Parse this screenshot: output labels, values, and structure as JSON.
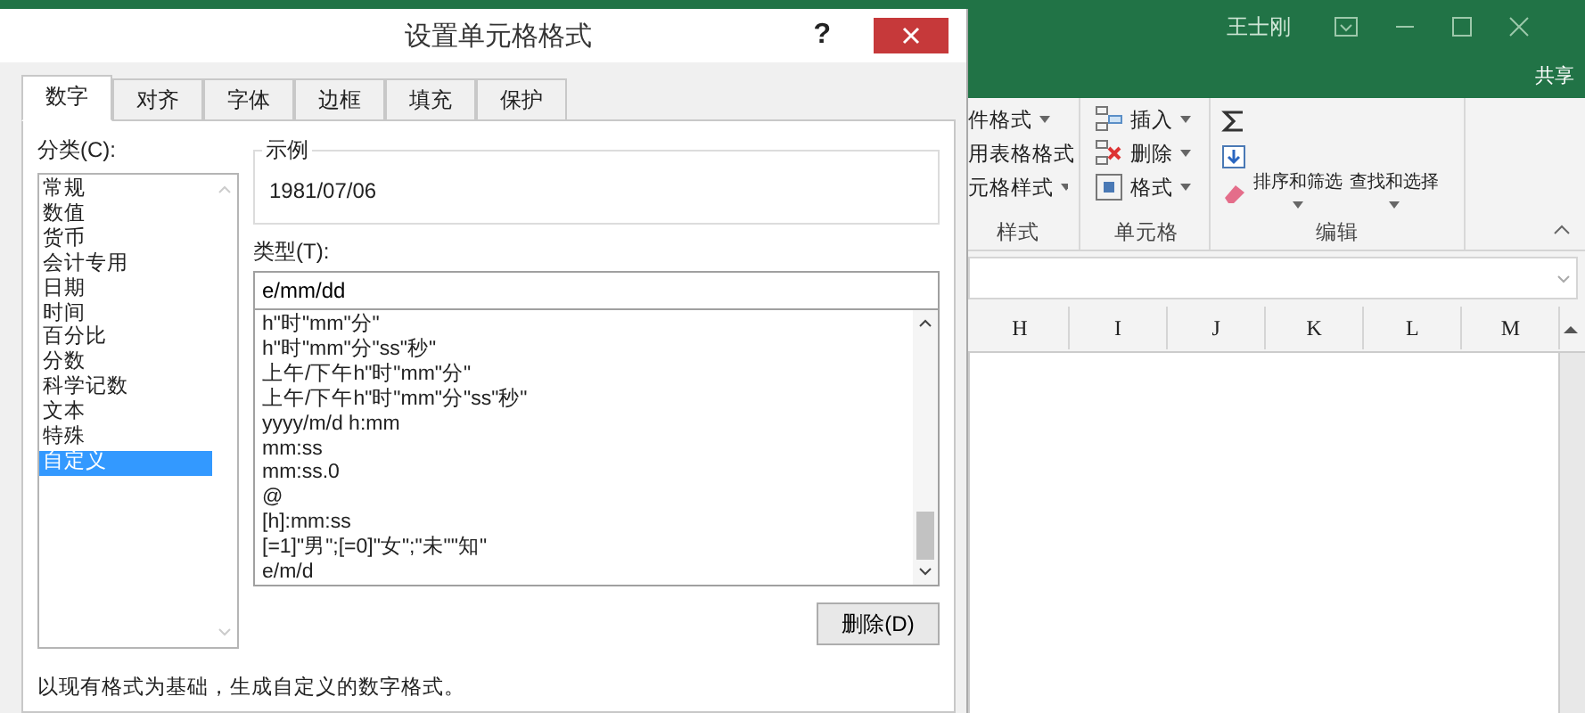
{
  "excel": {
    "user": "王士刚",
    "share": "共享",
    "styles_group": {
      "items": [
        "件格式",
        "用表格格式",
        "元格样式"
      ],
      "label": "样式"
    },
    "cells_group": {
      "items": [
        {
          "kind": "insert",
          "label": "插入"
        },
        {
          "kind": "delete",
          "label": "删除"
        },
        {
          "kind": "format",
          "label": "格式"
        }
      ],
      "label": "单元格"
    },
    "editing_group": {
      "buttons": [
        "排序和筛选",
        "查找和选择"
      ],
      "label": "编辑"
    },
    "columns": [
      "H",
      "I",
      "J",
      "K",
      "L",
      "M"
    ]
  },
  "dialog": {
    "title": "设置单元格格式",
    "help": "?",
    "tabs": [
      {
        "label": "数字",
        "selected": true
      },
      {
        "label": "对齐",
        "selected": false
      },
      {
        "label": "字体",
        "selected": false
      },
      {
        "label": "边框",
        "selected": false
      },
      {
        "label": "填充",
        "selected": false
      },
      {
        "label": "保护",
        "selected": false
      }
    ],
    "category_label": "分类(C):",
    "categories": [
      {
        "label": "常规",
        "selected": false
      },
      {
        "label": "数值",
        "selected": false
      },
      {
        "label": "货币",
        "selected": false
      },
      {
        "label": "会计专用",
        "selected": false
      },
      {
        "label": "日期",
        "selected": false
      },
      {
        "label": "时间",
        "selected": false
      },
      {
        "label": "百分比",
        "selected": false
      },
      {
        "label": "分数",
        "selected": false
      },
      {
        "label": "科学记数",
        "selected": false
      },
      {
        "label": "文本",
        "selected": false
      },
      {
        "label": "特殊",
        "selected": false
      },
      {
        "label": "自定义",
        "selected": true
      }
    ],
    "sample_label": "示例",
    "sample_value": "1981/07/06",
    "type_label": "类型(T):",
    "type_value": "e/mm/dd",
    "formats": [
      "h\"时\"mm\"分\"",
      "h\"时\"mm\"分\"ss\"秒\"",
      "上午/下午h\"时\"mm\"分\"",
      "上午/下午h\"时\"mm\"分\"ss\"秒\"",
      "yyyy/m/d h:mm",
      "mm:ss",
      "mm:ss.0",
      "@",
      "[h]:mm:ss",
      "[=1]\"男\";[=0]\"女\";\"未\"\"知\"",
      "e/m/d"
    ],
    "delete_button": "删除(D)",
    "description": "以现有格式为基础，生成自定义的数字格式。"
  }
}
